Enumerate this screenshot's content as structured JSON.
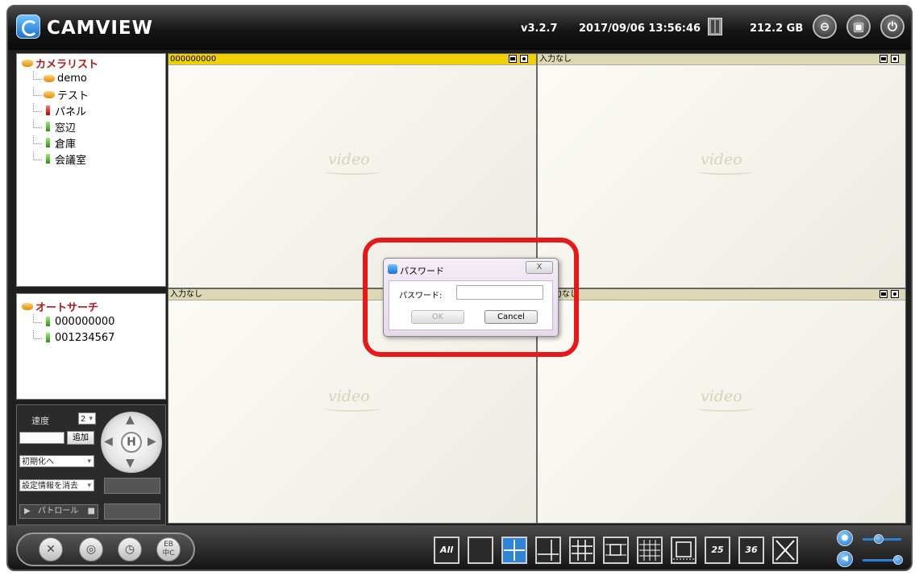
{
  "header": {
    "app_title": "CAMVIEW",
    "version": "v3.2.7",
    "datetime": "2017/09/06 13:56:46",
    "storage": "212.2 GB",
    "buttons": [
      "minimize-icon",
      "maximize-icon",
      "power-icon"
    ]
  },
  "camera_list": {
    "root_label": "カメラリスト",
    "items": [
      {
        "label": "demo",
        "icon": "disk"
      },
      {
        "label": "テスト",
        "icon": "disk"
      },
      {
        "label": "パネル",
        "icon": "camera-red"
      },
      {
        "label": "窓辺",
        "icon": "camera-green"
      },
      {
        "label": "倉庫",
        "icon": "camera-green"
      },
      {
        "label": "会議室",
        "icon": "camera-green"
      }
    ]
  },
  "auto_search": {
    "root_label": "オートサーチ",
    "items": [
      {
        "label": "000000000"
      },
      {
        "label": "001234567"
      }
    ]
  },
  "controls": {
    "speed_label": "速度",
    "speed_value": "2",
    "add_button": "追加",
    "reset_select": "初期化へ",
    "clear_select": "設定情報を消去",
    "patrol_label": "パトロール"
  },
  "video": {
    "cells": [
      {
        "title": "000000000",
        "watermark": "video",
        "active": true
      },
      {
        "title": "入力なし",
        "watermark": "video",
        "active": false
      },
      {
        "title": "入力なし",
        "watermark": "video",
        "active": false
      },
      {
        "title": "力なし",
        "watermark": "video",
        "active": false
      }
    ]
  },
  "dialog": {
    "title": "パスワード",
    "field_label": "パスワード:",
    "password_value": "",
    "ok_label": "OK",
    "cancel_label": "Cancel",
    "close_label": "X"
  },
  "bottom": {
    "layout_all_label": "All",
    "layout_25_label": "25",
    "layout_36_label": "36",
    "lang_label_top": "EB",
    "lang_label_bottom": "中C",
    "selected_layout": "4-split"
  },
  "colors": {
    "active_bar": "#f0d000",
    "highlight": "#e81818",
    "accent": "#2e85d6"
  }
}
